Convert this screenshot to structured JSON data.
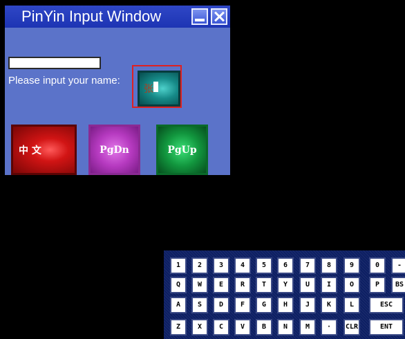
{
  "window": {
    "title": "PinYin Input Window",
    "name_input_value": "",
    "name_label": "Please input your name:",
    "preview_char": "张",
    "buttons": {
      "chinese": "中 文",
      "pgdn": "PgDn",
      "pgup": "PgUp"
    }
  },
  "keyboard": {
    "row1": [
      "1",
      "2",
      "3",
      "4",
      "5",
      "6",
      "7",
      "8",
      "9",
      "0",
      "-"
    ],
    "row2": [
      "Q",
      "W",
      "E",
      "R",
      "T",
      "Y",
      "U",
      "I",
      "O",
      "P",
      "BS"
    ],
    "row3": [
      "A",
      "S",
      "D",
      "F",
      "G",
      "H",
      "J",
      "K",
      "L",
      "ESC"
    ],
    "row4": [
      "Z",
      "X",
      "C",
      "V",
      "B",
      "N",
      "M",
      "·",
      "CLR",
      "ENT"
    ]
  },
  "colors": {
    "window_bg": "#5b73c9",
    "titlebar": "#2f47c6",
    "focus_frame": "#e02020",
    "keyboard_bg": "#0d1f63"
  },
  "icons": {
    "minimize": "minimize-icon",
    "close": "close-icon"
  }
}
